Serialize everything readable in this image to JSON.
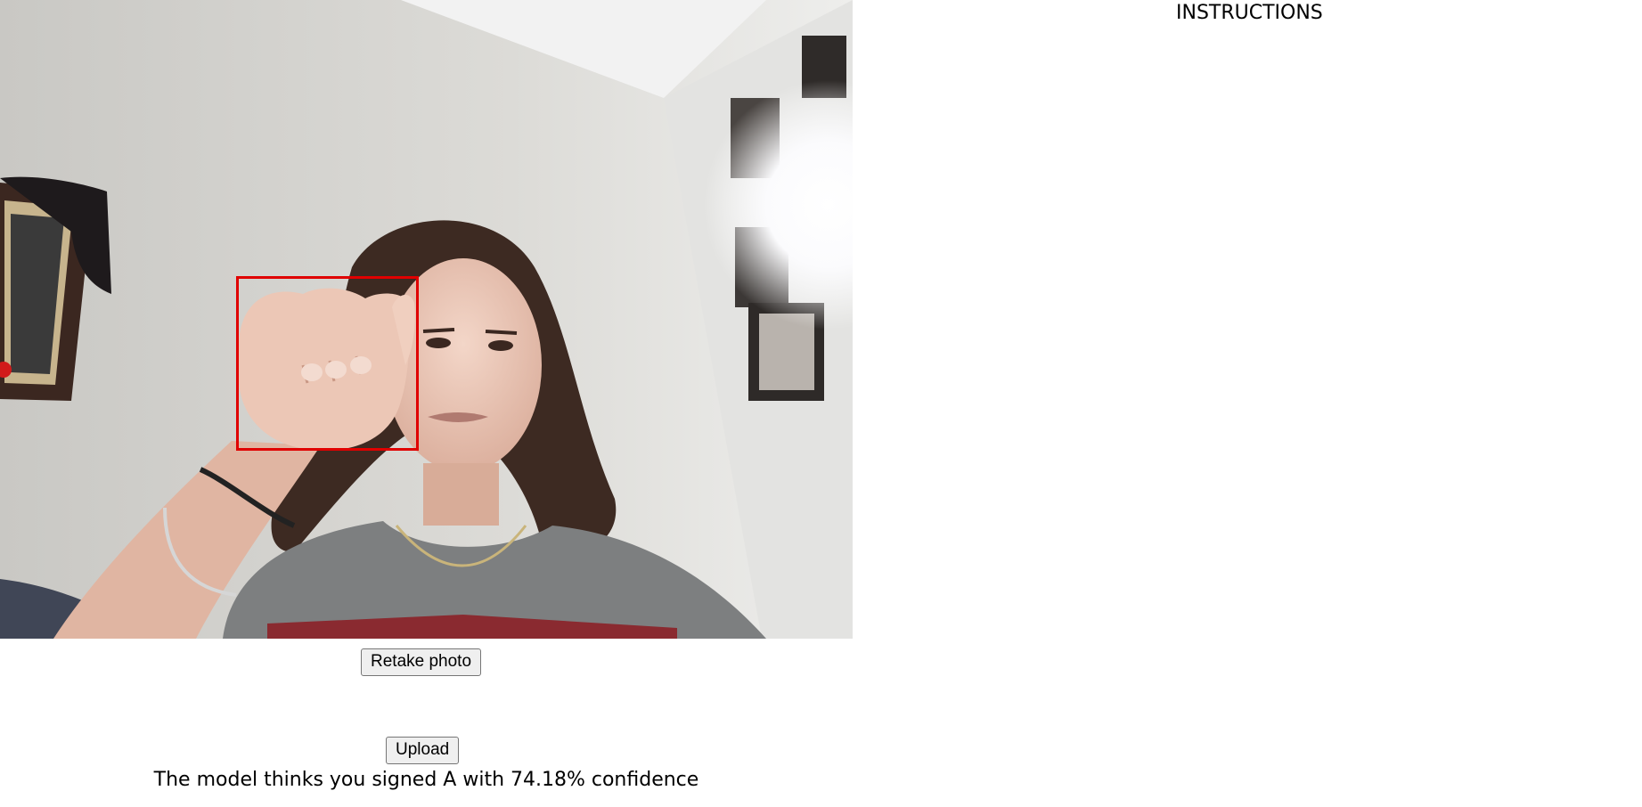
{
  "camera": {
    "has_detection_box": true,
    "detection_box_color": "#e00000"
  },
  "buttons": {
    "retake_label": "Retake photo",
    "upload_label": "Upload"
  },
  "result": {
    "text": "The model thinks you signed A with 74.18% confidence"
  },
  "instructions": {
    "title": "INSTRUCTIONS"
  }
}
